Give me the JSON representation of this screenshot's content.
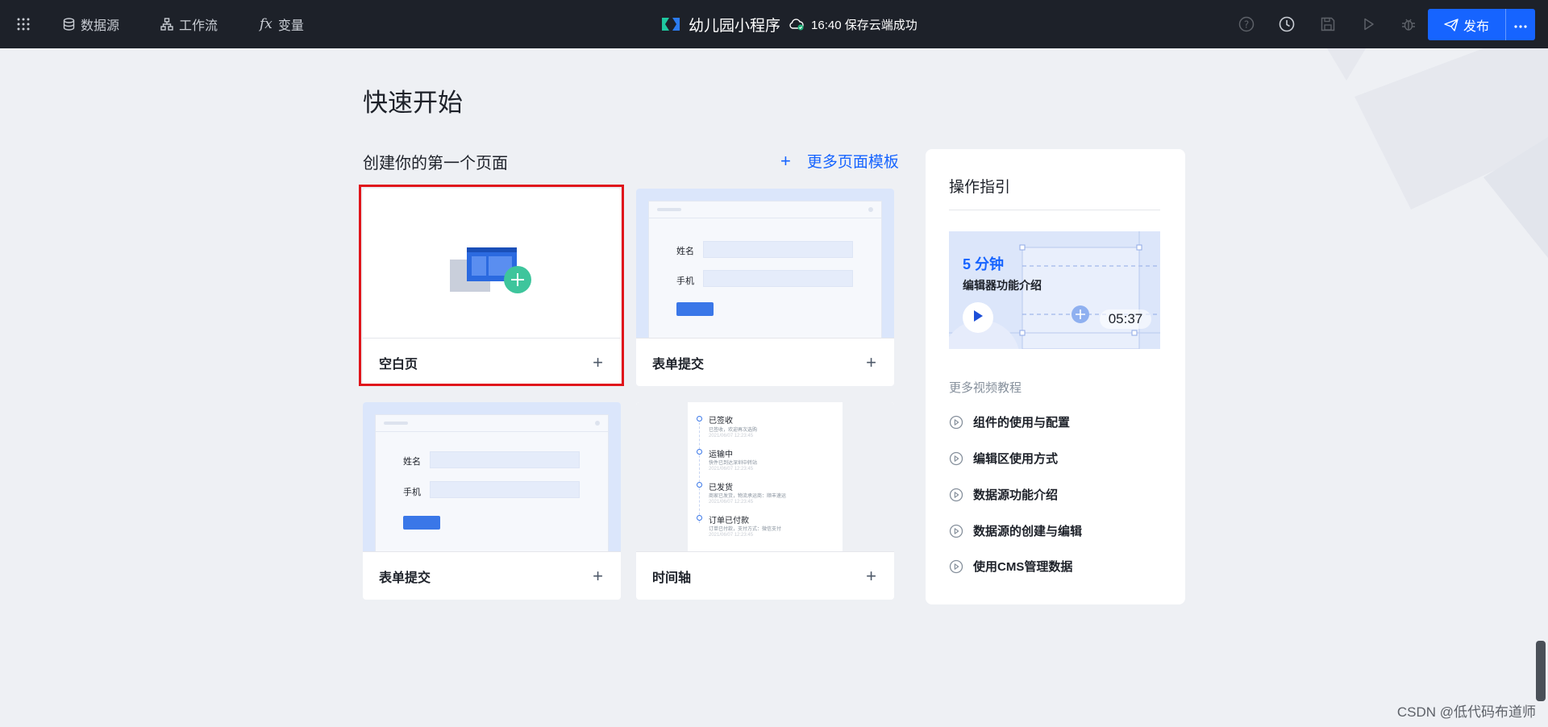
{
  "topbar": {
    "menu_icon": "grid-icon",
    "nav": [
      {
        "label": "数据源",
        "icon": "database-icon"
      },
      {
        "label": "工作流",
        "icon": "workflow-icon"
      },
      {
        "label": "变量",
        "icon": "fx-icon"
      }
    ],
    "app_title": "幼儿园小程序",
    "save_status": "16:40 保存云端成功",
    "tools": [
      "help-icon",
      "history-icon",
      "save-icon",
      "preview-icon",
      "debug-icon"
    ],
    "publish_label": "发布",
    "colors": {
      "bar": "#1d2129",
      "publish": "#1664ff"
    }
  },
  "main": {
    "page_title": "快速开始",
    "section_title": "创建你的第一个页面",
    "more_templates_label": "更多页面模板",
    "cards": [
      {
        "label": "空白页",
        "selected": true
      },
      {
        "label": "表单提交",
        "form_labels": [
          "姓名",
          "手机"
        ]
      },
      {
        "label": "表单提交",
        "form_labels": [
          "姓名",
          "手机"
        ]
      },
      {
        "label": "时间轴"
      }
    ],
    "timeline_items": [
      {
        "title": "已签收",
        "desc": "已签收，欢迎再次选购",
        "time": "2021/06/07  12:23:45"
      },
      {
        "title": "运输中",
        "desc": "快件已到达深圳中转站",
        "time": "2021/06/07  12:23:45"
      },
      {
        "title": "已发货",
        "desc": "商家已发货，物流承运商：顺丰速运",
        "time": "2021/06/07  12:23:45"
      },
      {
        "title": "订单已付款",
        "desc": "订单已付款，支付方式：微信支付",
        "time": "2021/06/07  12:23:45"
      }
    ]
  },
  "guide": {
    "title": "操作指引",
    "video": {
      "duration_label": "5 分钟",
      "title": "编辑器功能介绍",
      "time": "05:37"
    },
    "more_label": "更多视频教程",
    "tutorials": [
      "组件的使用与配置",
      "编辑区使用方式",
      "数据源功能介绍",
      "数据源的创建与编辑",
      "使用CMS管理数据"
    ]
  },
  "watermark": "CSDN @低代码布道师"
}
